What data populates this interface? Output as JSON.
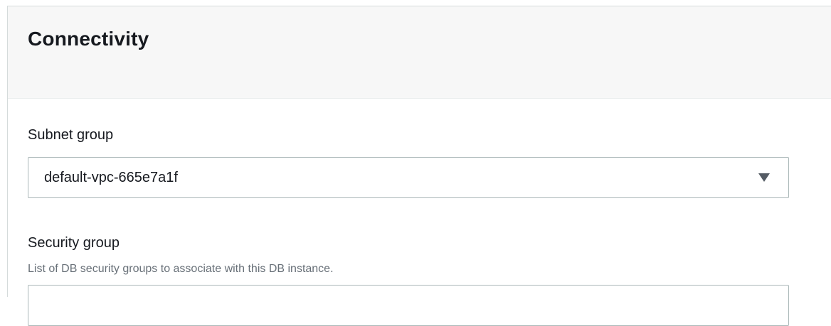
{
  "section": {
    "title": "Connectivity"
  },
  "subnet_group": {
    "label": "Subnet group",
    "selected_value": "default-vpc-665e7a1f"
  },
  "security_group": {
    "label": "Security group",
    "description": "List of DB security groups to associate with this DB instance."
  },
  "icons": {
    "dropdown": "caret-down-icon"
  }
}
